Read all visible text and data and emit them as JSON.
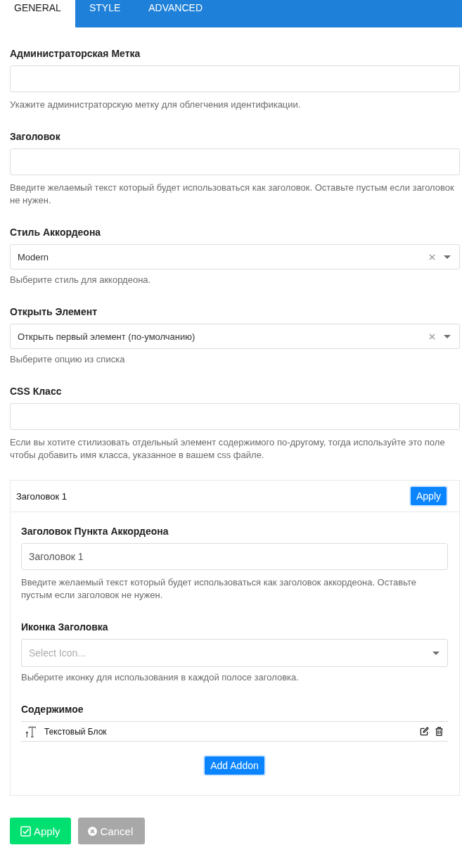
{
  "tabs": [
    {
      "label": "GENERAL",
      "selected": true
    },
    {
      "label": "STYLE",
      "selected": false
    },
    {
      "label": "ADVANCED",
      "selected": false
    }
  ],
  "fields": [
    {
      "kind": "text",
      "label": "Администраторская Метка",
      "help": "Укажите администраторскую метку для облегчения идентификации."
    },
    {
      "kind": "text",
      "label": "Заголовок",
      "help": "Введите желаемый текст который будет использоваться как заголовок. Оставьте пустым если заголовок не нужен."
    },
    {
      "kind": "select",
      "label": "Стиль Аккордеона",
      "value": "Modern",
      "help": "Выберите стиль для аккордеона."
    },
    {
      "kind": "select",
      "label": "Открыть Элемент",
      "value": "Открыть первый элемент (по-умолчанию)",
      "help": "Выберите опцию из списка"
    },
    {
      "kind": "text",
      "label": "CSS Класс",
      "help": "Если вы хотите стилизовать отдельный элемент содержимого по-другому, тогда используйте это поле чтобы добавить имя класса, указанное в вашем css файле."
    }
  ],
  "accordion_item": {
    "title": "Заголовок 1",
    "apply_button": "Apply",
    "fields": [
      {
        "kind": "text",
        "label": "Заголовок Пункта Аккордеона",
        "value": "Заголовок 1",
        "help": "Введите желаемый текст который будет использоваться как заголовок аккордеона. Оставьте пустым если заголовок не нужен."
      },
      {
        "kind": "icon_select",
        "label": "Иконка Заголовка",
        "placeholder": "Select Icon...",
        "help": "Выберите иконку для использования в каждой полосе заголовка."
      }
    ],
    "content": {
      "label": "Содержимое",
      "addons": [
        {
          "name": "Текстовый Блок"
        }
      ]
    },
    "add_button": "Add Addon"
  },
  "footer": {
    "buttons": [
      {
        "kind": "apply",
        "label": "Apply"
      },
      {
        "kind": "cancel",
        "label": "Cancel"
      }
    ]
  }
}
